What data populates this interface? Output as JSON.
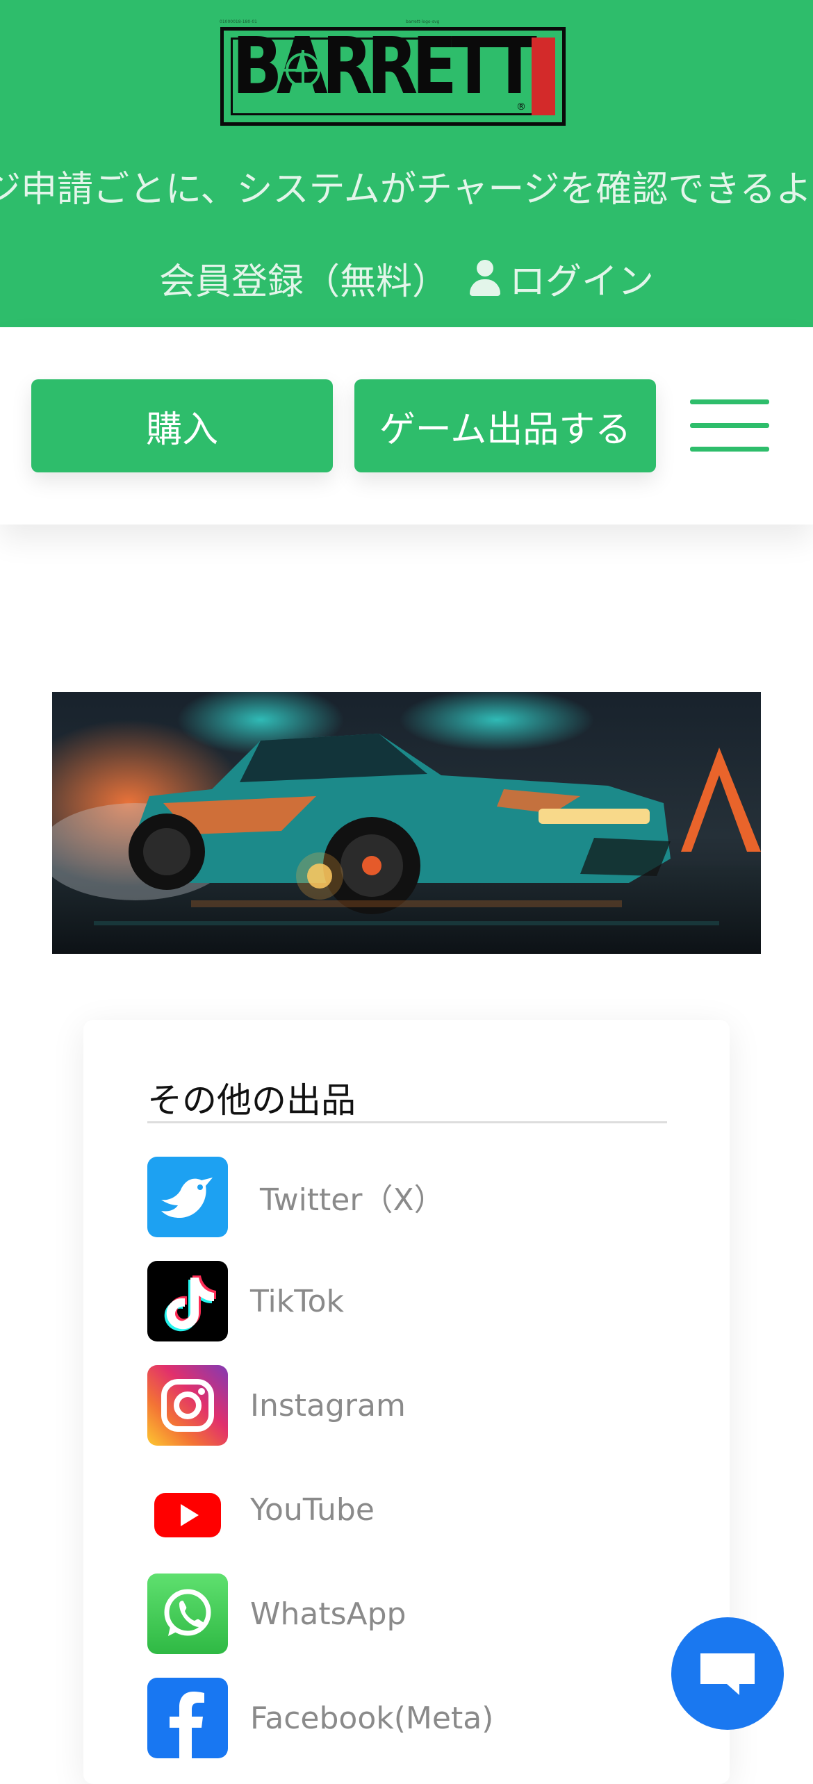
{
  "header": {
    "brand": "BARRETT",
    "registered_mark": "®",
    "micro_left": "01000018-180-01",
    "micro_right": "barrett-logo-svg",
    "marquee": "ジ申請ごとに、システムがチャージを確認できるよ",
    "register_link": "会員登録（無料）",
    "login_link": "ログイン"
  },
  "toolbar": {
    "buy_label": "購入",
    "sell_label": "ゲーム出品する"
  },
  "other_listings": {
    "title": "その他の出品",
    "items": [
      {
        "label": "Twitter（X）",
        "icon": "twitter-bird-icon"
      },
      {
        "label": "TikTok",
        "icon": "tiktok-icon"
      },
      {
        "label": "Instagram",
        "icon": "instagram-icon"
      },
      {
        "label": "YouTube",
        "icon": "youtube-icon"
      },
      {
        "label": "WhatsApp",
        "icon": "whatsapp-icon"
      },
      {
        "label": "Facebook(Meta)",
        "icon": "facebook-icon"
      }
    ]
  },
  "colors": {
    "brand_green": "#2ebd6b",
    "logo_red": "#d32a2a",
    "chat_blue": "#1a78f0"
  }
}
